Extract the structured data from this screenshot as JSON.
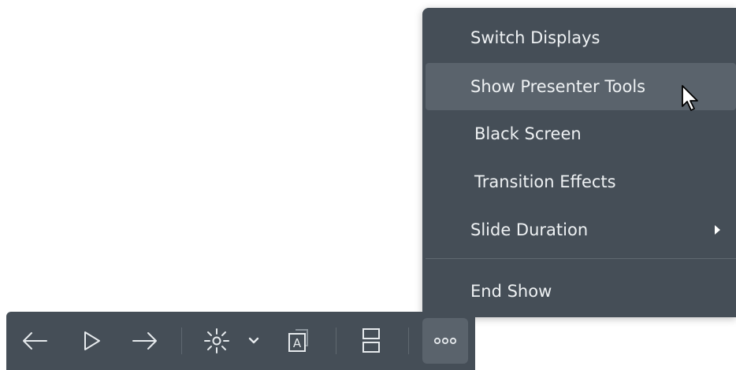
{
  "menu": {
    "items": [
      {
        "label": "Switch Displays"
      },
      {
        "label": "Show Presenter Tools"
      },
      {
        "label": "Black Screen"
      },
      {
        "label": "Transition Effects"
      },
      {
        "label": "Slide Duration"
      },
      {
        "label": "End Show"
      }
    ],
    "hovered_item": "Show Presenter Tools"
  },
  "toolbar": {
    "buttons": [
      {
        "icon": "arrow-left-icon"
      },
      {
        "icon": "play-icon"
      },
      {
        "icon": "arrow-right-icon"
      },
      {
        "icon": "laser-pointer-icon"
      },
      {
        "icon": "chevron-down-icon"
      },
      {
        "icon": "subtitles-icon"
      },
      {
        "icon": "split-view-icon"
      },
      {
        "icon": "more-icon"
      }
    ]
  },
  "colors": {
    "panel": "#454e57",
    "hover": "#5a636c",
    "text": "#eef1f3"
  }
}
